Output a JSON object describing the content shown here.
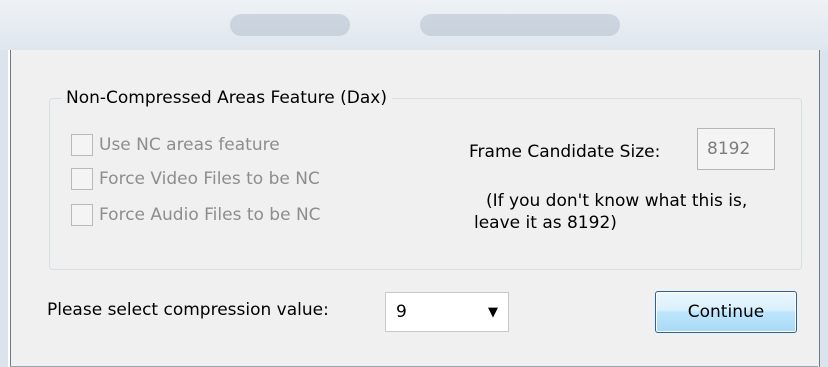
{
  "group": {
    "title": "Non-Compressed Areas Feature (Dax)"
  },
  "checkboxes": [
    {
      "label": "Use NC areas feature",
      "checked": false,
      "enabled": false
    },
    {
      "label": "Force Video Files to be NC",
      "checked": false,
      "enabled": false
    },
    {
      "label": "Force Audio Files to be NC",
      "checked": false,
      "enabled": false
    }
  ],
  "frame": {
    "label": "Frame Candidate Size:",
    "value": "8192",
    "hint_line1": "(If you don't know what this is,",
    "hint_line2": "leave it as 8192)"
  },
  "compression": {
    "label": "Please select compression value:",
    "value": "9"
  },
  "buttons": {
    "continue": "Continue"
  },
  "icons": {
    "dropdown": "chevron-down-icon"
  }
}
